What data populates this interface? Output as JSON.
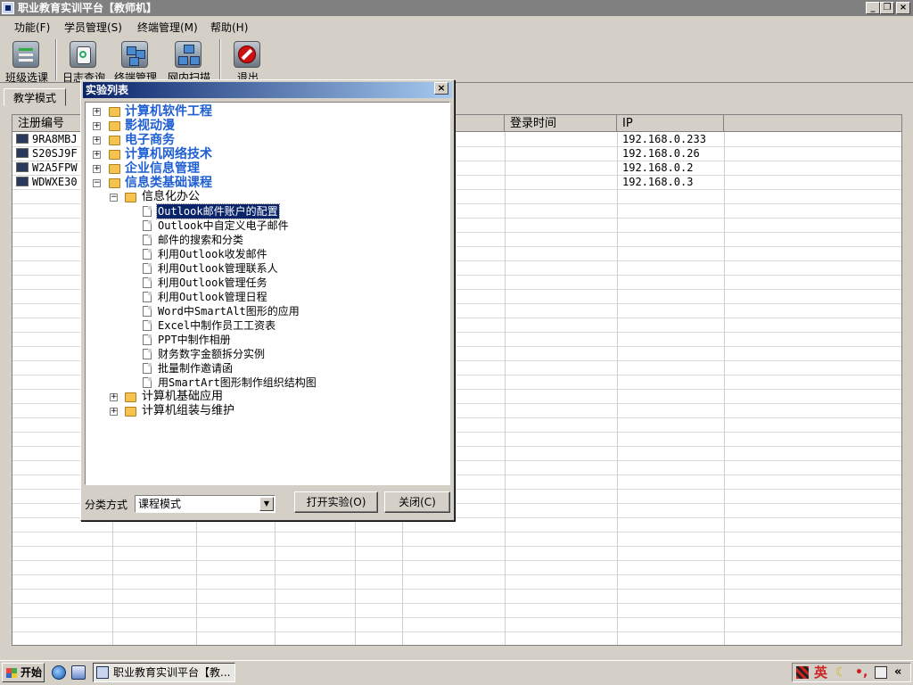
{
  "window": {
    "title": "职业教育实训平台【教师机】"
  },
  "menu": [
    {
      "label": "功能(F)"
    },
    {
      "label": "学员管理(S)"
    },
    {
      "label": "终端管理(M)"
    },
    {
      "label": "帮助(H)"
    }
  ],
  "toolbar": [
    {
      "label": "班级选课",
      "icon": "class-select-icon"
    },
    {
      "label": "日志查询",
      "icon": "log-query-icon"
    },
    {
      "label": "终端管理",
      "icon": "terminal-manage-icon"
    },
    {
      "label": "网内扫描",
      "icon": "network-scan-icon"
    },
    {
      "label": "退出",
      "icon": "exit-icon",
      "color": "#cc1010"
    }
  ],
  "tabs": [
    {
      "label": "教学模式"
    }
  ],
  "grid": {
    "columns": [
      "注册编号",
      "",
      "",
      "",
      "",
      "",
      "登录时间",
      "IP"
    ],
    "rows": [
      {
        "id": "9RA8MBJ",
        "login_time": "",
        "ip": "192.168.0.233"
      },
      {
        "id": "S20SJ9F",
        "login_time": "",
        "ip": "192.168.0.26"
      },
      {
        "id": "W2A5FPW",
        "login_time": "",
        "ip": "192.168.0.2"
      },
      {
        "id": "WDWXE30",
        "login_time": "",
        "ip": "192.168.0.3"
      }
    ]
  },
  "dialog": {
    "title": "实验列表",
    "tree": {
      "categories": [
        {
          "label": "计算机软件工程",
          "expanded": false
        },
        {
          "label": "影视动漫",
          "expanded": false
        },
        {
          "label": "电子商务",
          "expanded": false
        },
        {
          "label": "计算机网络技术",
          "expanded": false
        },
        {
          "label": "企业信息管理",
          "expanded": false
        },
        {
          "label": "信息类基础课程",
          "expanded": true
        }
      ],
      "subcategories": [
        {
          "label": "信息化办公",
          "expanded": true
        },
        {
          "label": "计算机基础应用",
          "expanded": false
        },
        {
          "label": "计算机组装与维护",
          "expanded": false
        }
      ],
      "items": [
        {
          "label": "Outlook邮件账户的配置",
          "selected": true
        },
        {
          "label": "Outlook中自定义电子邮件"
        },
        {
          "label": "邮件的搜索和分类"
        },
        {
          "label": "利用Outlook收发邮件"
        },
        {
          "label": "利用Outlook管理联系人"
        },
        {
          "label": "利用Outlook管理任务"
        },
        {
          "label": "利用Outlook管理日程"
        },
        {
          "label": "Word中SmartAlt图形的应用"
        },
        {
          "label": "Excel中制作员工工资表"
        },
        {
          "label": "PPT中制作相册"
        },
        {
          "label": "财务数字金额拆分实例"
        },
        {
          "label": "批量制作邀请函"
        },
        {
          "label": "用SmartArt图形制作组织结构图"
        }
      ]
    },
    "sort_label": "分类方式",
    "sort_value": "课程模式",
    "open_button": "打开实验(O)",
    "close_button": "关闭(C)"
  },
  "taskbar": {
    "start_label": "开始",
    "task_label": "职业教育实训平台【教...",
    "ime_label": "英",
    "tray_more": "«"
  },
  "colors": {
    "category_text": "#1f5fd2",
    "selection_bg": "#0a246a",
    "titlebar_inactive": "#808080",
    "folder": "#f5c350"
  }
}
